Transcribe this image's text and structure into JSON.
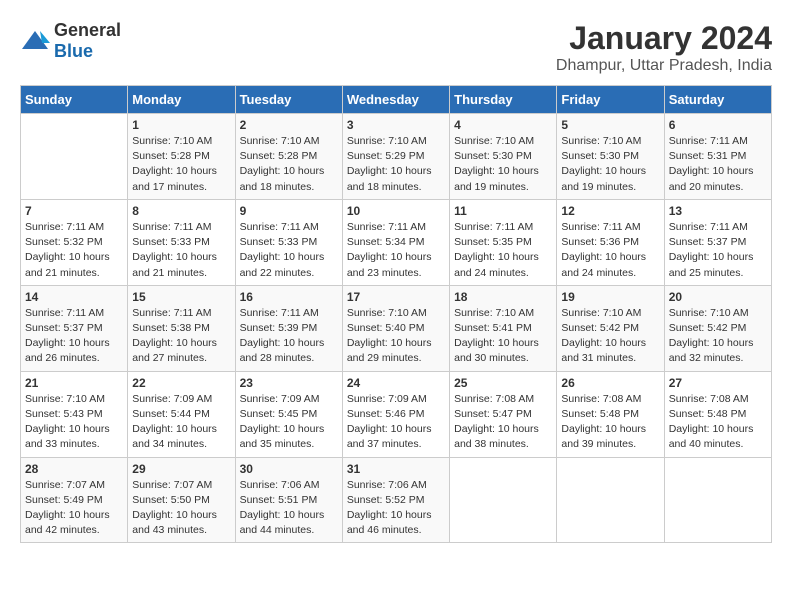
{
  "logo": {
    "general": "General",
    "blue": "Blue"
  },
  "title": "January 2024",
  "subtitle": "Dhampur, Uttar Pradesh, India",
  "days_header": [
    "Sunday",
    "Monday",
    "Tuesday",
    "Wednesday",
    "Thursday",
    "Friday",
    "Saturday"
  ],
  "weeks": [
    [
      {
        "day": "",
        "info": ""
      },
      {
        "day": "1",
        "info": "Sunrise: 7:10 AM\nSunset: 5:28 PM\nDaylight: 10 hours\nand 17 minutes."
      },
      {
        "day": "2",
        "info": "Sunrise: 7:10 AM\nSunset: 5:28 PM\nDaylight: 10 hours\nand 18 minutes."
      },
      {
        "day": "3",
        "info": "Sunrise: 7:10 AM\nSunset: 5:29 PM\nDaylight: 10 hours\nand 18 minutes."
      },
      {
        "day": "4",
        "info": "Sunrise: 7:10 AM\nSunset: 5:30 PM\nDaylight: 10 hours\nand 19 minutes."
      },
      {
        "day": "5",
        "info": "Sunrise: 7:10 AM\nSunset: 5:30 PM\nDaylight: 10 hours\nand 19 minutes."
      },
      {
        "day": "6",
        "info": "Sunrise: 7:11 AM\nSunset: 5:31 PM\nDaylight: 10 hours\nand 20 minutes."
      }
    ],
    [
      {
        "day": "7",
        "info": "Sunrise: 7:11 AM\nSunset: 5:32 PM\nDaylight: 10 hours\nand 21 minutes."
      },
      {
        "day": "8",
        "info": "Sunrise: 7:11 AM\nSunset: 5:33 PM\nDaylight: 10 hours\nand 21 minutes."
      },
      {
        "day": "9",
        "info": "Sunrise: 7:11 AM\nSunset: 5:33 PM\nDaylight: 10 hours\nand 22 minutes."
      },
      {
        "day": "10",
        "info": "Sunrise: 7:11 AM\nSunset: 5:34 PM\nDaylight: 10 hours\nand 23 minutes."
      },
      {
        "day": "11",
        "info": "Sunrise: 7:11 AM\nSunset: 5:35 PM\nDaylight: 10 hours\nand 24 minutes."
      },
      {
        "day": "12",
        "info": "Sunrise: 7:11 AM\nSunset: 5:36 PM\nDaylight: 10 hours\nand 24 minutes."
      },
      {
        "day": "13",
        "info": "Sunrise: 7:11 AM\nSunset: 5:37 PM\nDaylight: 10 hours\nand 25 minutes."
      }
    ],
    [
      {
        "day": "14",
        "info": "Sunrise: 7:11 AM\nSunset: 5:37 PM\nDaylight: 10 hours\nand 26 minutes."
      },
      {
        "day": "15",
        "info": "Sunrise: 7:11 AM\nSunset: 5:38 PM\nDaylight: 10 hours\nand 27 minutes."
      },
      {
        "day": "16",
        "info": "Sunrise: 7:11 AM\nSunset: 5:39 PM\nDaylight: 10 hours\nand 28 minutes."
      },
      {
        "day": "17",
        "info": "Sunrise: 7:10 AM\nSunset: 5:40 PM\nDaylight: 10 hours\nand 29 minutes."
      },
      {
        "day": "18",
        "info": "Sunrise: 7:10 AM\nSunset: 5:41 PM\nDaylight: 10 hours\nand 30 minutes."
      },
      {
        "day": "19",
        "info": "Sunrise: 7:10 AM\nSunset: 5:42 PM\nDaylight: 10 hours\nand 31 minutes."
      },
      {
        "day": "20",
        "info": "Sunrise: 7:10 AM\nSunset: 5:42 PM\nDaylight: 10 hours\nand 32 minutes."
      }
    ],
    [
      {
        "day": "21",
        "info": "Sunrise: 7:10 AM\nSunset: 5:43 PM\nDaylight: 10 hours\nand 33 minutes."
      },
      {
        "day": "22",
        "info": "Sunrise: 7:09 AM\nSunset: 5:44 PM\nDaylight: 10 hours\nand 34 minutes."
      },
      {
        "day": "23",
        "info": "Sunrise: 7:09 AM\nSunset: 5:45 PM\nDaylight: 10 hours\nand 35 minutes."
      },
      {
        "day": "24",
        "info": "Sunrise: 7:09 AM\nSunset: 5:46 PM\nDaylight: 10 hours\nand 37 minutes."
      },
      {
        "day": "25",
        "info": "Sunrise: 7:08 AM\nSunset: 5:47 PM\nDaylight: 10 hours\nand 38 minutes."
      },
      {
        "day": "26",
        "info": "Sunrise: 7:08 AM\nSunset: 5:48 PM\nDaylight: 10 hours\nand 39 minutes."
      },
      {
        "day": "27",
        "info": "Sunrise: 7:08 AM\nSunset: 5:48 PM\nDaylight: 10 hours\nand 40 minutes."
      }
    ],
    [
      {
        "day": "28",
        "info": "Sunrise: 7:07 AM\nSunset: 5:49 PM\nDaylight: 10 hours\nand 42 minutes."
      },
      {
        "day": "29",
        "info": "Sunrise: 7:07 AM\nSunset: 5:50 PM\nDaylight: 10 hours\nand 43 minutes."
      },
      {
        "day": "30",
        "info": "Sunrise: 7:06 AM\nSunset: 5:51 PM\nDaylight: 10 hours\nand 44 minutes."
      },
      {
        "day": "31",
        "info": "Sunrise: 7:06 AM\nSunset: 5:52 PM\nDaylight: 10 hours\nand 46 minutes."
      },
      {
        "day": "",
        "info": ""
      },
      {
        "day": "",
        "info": ""
      },
      {
        "day": "",
        "info": ""
      }
    ]
  ]
}
